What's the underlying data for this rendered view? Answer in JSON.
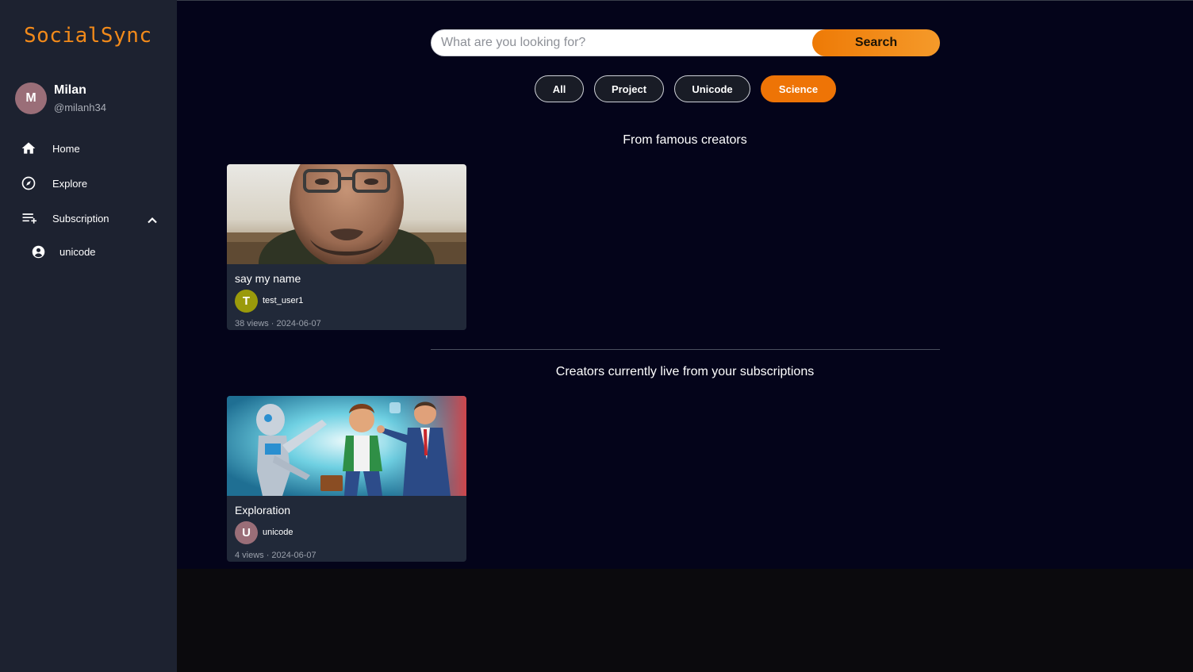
{
  "brand": "SocialSync",
  "profile": {
    "initial": "M",
    "name": "Milan",
    "handle": "@milanh34",
    "avatar_color": "#9a6e78"
  },
  "nav": [
    {
      "label": "Home",
      "icon": "home-icon"
    },
    {
      "label": "Explore",
      "icon": "compass-icon"
    },
    {
      "label": "Subscription",
      "icon": "playlist-add-icon"
    }
  ],
  "subscriptions": [
    {
      "label": "unicode",
      "icon": "account-circle-icon"
    }
  ],
  "search": {
    "placeholder": "What are you looking for?",
    "value": "",
    "button_label": "Search"
  },
  "filters": [
    {
      "label": "All",
      "active": false
    },
    {
      "label": "Project",
      "active": false
    },
    {
      "label": "Unicode",
      "active": false
    },
    {
      "label": "Science",
      "active": true
    }
  ],
  "sections": {
    "famous_title": "From famous creators",
    "live_title": "Creators currently live from your subscriptions"
  },
  "cards": [
    {
      "title": "say my name",
      "author_initial": "T",
      "author": "test_user1",
      "avatar_color": "#9a9a0b",
      "views": "38 views",
      "date": "2024-06-07"
    },
    {
      "title": "Exploration",
      "author_initial": "U",
      "author": "unicode",
      "avatar_color": "#9a6e78",
      "views": "4 views",
      "date": "2024-06-07"
    }
  ],
  "meta_separator": "·",
  "colors": {
    "accent": "#ee7406",
    "sidebar_bg": "#1d2230",
    "main_bg": "#04041a",
    "card_bg": "#212939"
  }
}
